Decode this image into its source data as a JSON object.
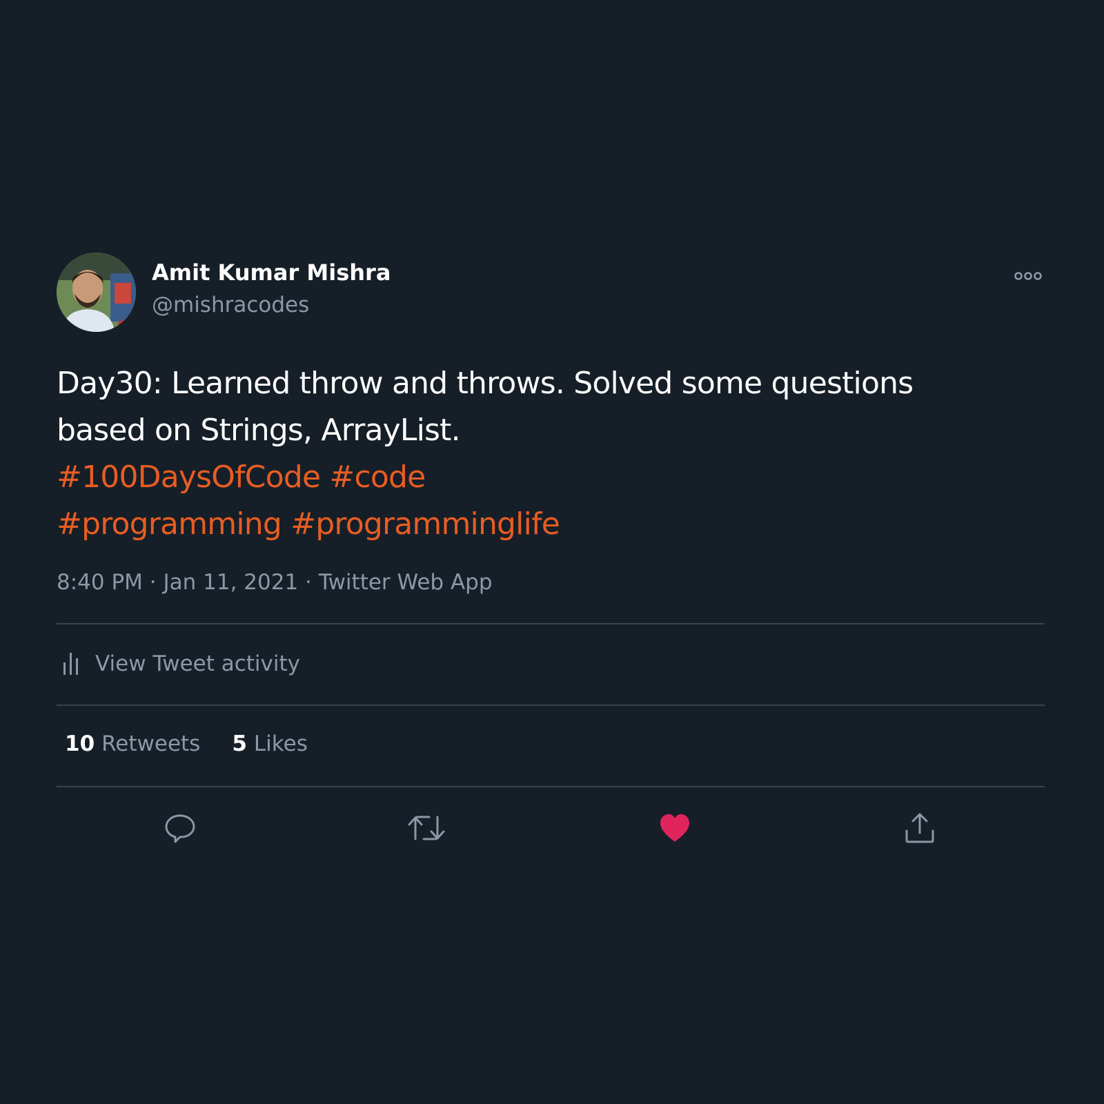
{
  "author": {
    "display_name": "Amit Kumar Mishra",
    "handle": "@mishracodes",
    "avatar_icon": "profile-photo"
  },
  "tweet": {
    "text_line_1": "Day30: Learned throw and throws. Solved some questions",
    "text_line_2": "based on Strings, ArrayList.",
    "hashtags_line_1": [
      "#100DaysOfCode",
      "#code"
    ],
    "hashtags_line_2": [
      "#programming",
      "#programminglife"
    ]
  },
  "meta": {
    "time": "8:40 PM",
    "separator": "·",
    "date": "Jan 11, 2021",
    "source": "Twitter Web App"
  },
  "activity": {
    "label": "View Tweet activity",
    "icon": "bar-chart-icon"
  },
  "stats": {
    "retweets_count": "10",
    "retweets_label": "Retweets",
    "likes_count": "5",
    "likes_label": "Likes"
  },
  "actions": {
    "icons": [
      "reply-icon",
      "retweet-icon",
      "like-icon",
      "share-icon"
    ],
    "liked": true
  },
  "colors": {
    "background": "#161e28",
    "text_primary": "#ffffff",
    "text_secondary": "#8b98a5",
    "hashtag": "#e85d22",
    "like_active": "#e0245e",
    "divider": "#38444d"
  }
}
